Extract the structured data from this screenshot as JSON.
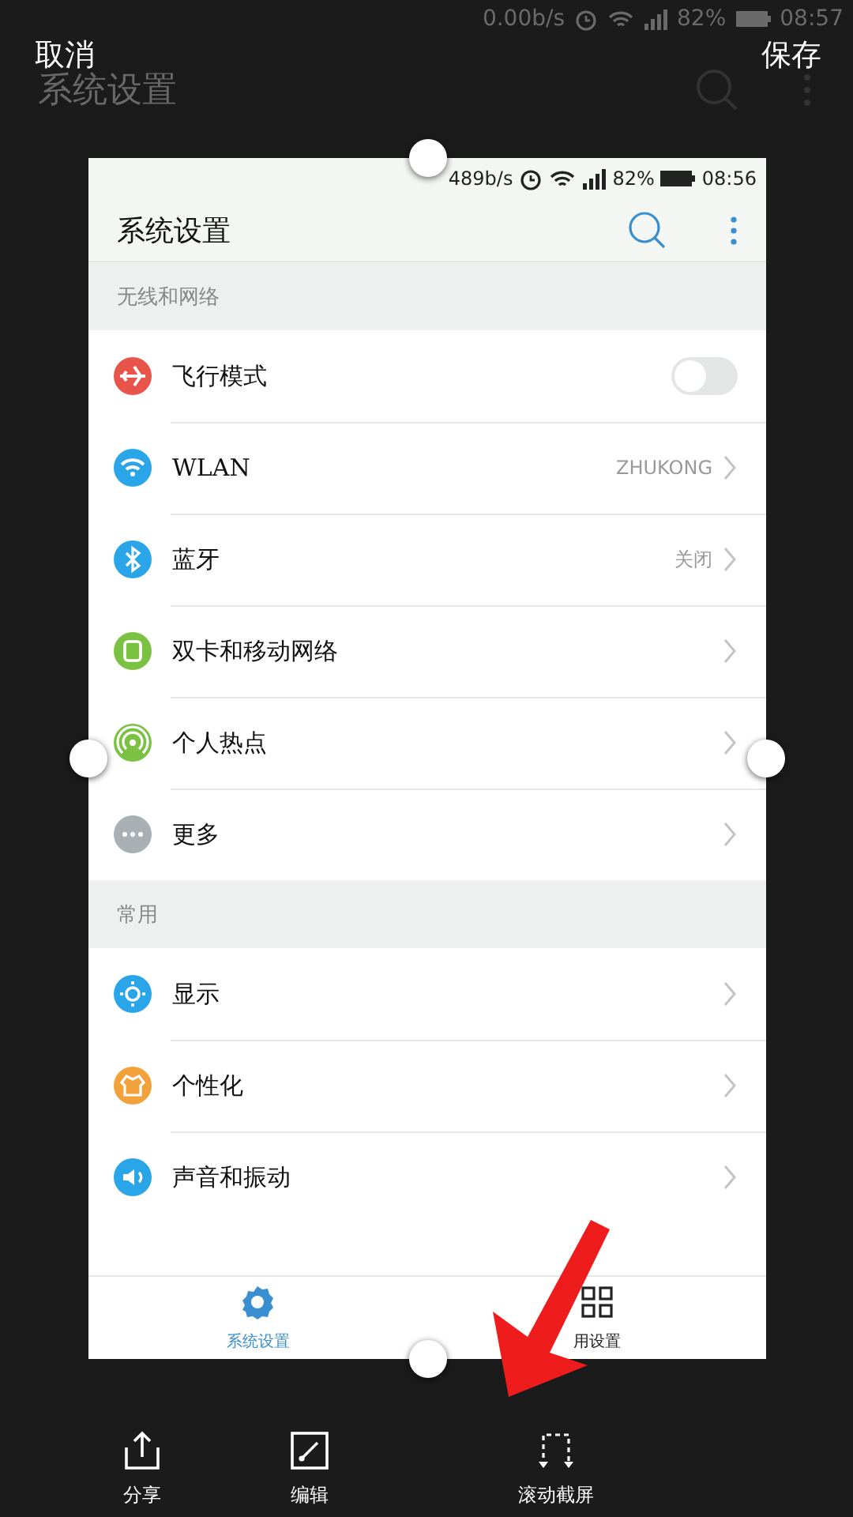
{
  "editor": {
    "cancel": "取消",
    "save": "保存"
  },
  "background": {
    "status": {
      "speed": "0.00b/s",
      "battery": "82%",
      "time": "08:57"
    },
    "title": "系统设置"
  },
  "preview": {
    "status": {
      "speed": "489b/s",
      "battery": "82%",
      "time": "08:56"
    },
    "title": "系统设置",
    "sections": [
      {
        "title": "无线和网络",
        "rows": [
          {
            "kind": "toggle",
            "label": "飞行模式",
            "color": "#e8534a",
            "on": false
          },
          {
            "kind": "link",
            "label": "WLAN",
            "value": "ZHUKONG",
            "color": "#2aa6e8"
          },
          {
            "kind": "link",
            "label": "蓝牙",
            "value": "关闭",
            "color": "#2aa6e8"
          },
          {
            "kind": "link",
            "label": "双卡和移动网络",
            "color": "#7cc242"
          },
          {
            "kind": "link",
            "label": "个人热点",
            "color": "#7cc242"
          },
          {
            "kind": "link",
            "label": "更多",
            "color": "#a9b0b4"
          }
        ]
      },
      {
        "title": "常用",
        "rows": [
          {
            "kind": "link",
            "label": "显示",
            "color": "#2aa6e8"
          },
          {
            "kind": "link",
            "label": "个性化",
            "color": "#f2a23a"
          },
          {
            "kind": "link",
            "label": "声音和振动",
            "color": "#2aa6e8"
          }
        ]
      }
    ],
    "tabs": [
      {
        "label": "系统设置",
        "selected": true
      },
      {
        "label": "用设置",
        "selected": false
      }
    ]
  },
  "toolbar": [
    {
      "label": "分享"
    },
    {
      "label": "编辑"
    },
    {
      "label": "滚动截屏"
    }
  ]
}
